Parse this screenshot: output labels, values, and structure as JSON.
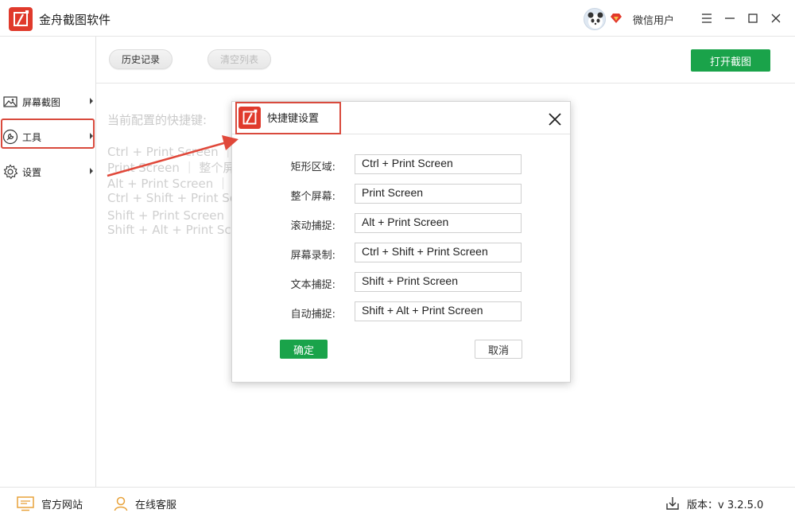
{
  "app": {
    "title": "金舟截图软件"
  },
  "header": {
    "user_name": "微信用户"
  },
  "sidebar": {
    "items": [
      {
        "label": "屏幕截图"
      },
      {
        "label": "工具"
      },
      {
        "label": "设置"
      }
    ]
  },
  "toolbar": {
    "history_label": "历史记录",
    "clear_label": "清空列表",
    "open_label": "打开截图"
  },
  "main": {
    "current_label": "当前配置的快捷键:",
    "lines": [
      "Ctrl + Print Screen ｜ 矩",
      "Print Screen ｜ 整个屏",
      "Alt + Print Screen ｜ 滚",
      "Ctrl + Shift + Print Scre",
      "Shift + Print Screen ｜",
      "Shift + Alt + Print Scre"
    ]
  },
  "dialog": {
    "title": "快捷键设置",
    "rows": [
      {
        "label": "矩形区域:",
        "value": "Ctrl + Print Screen"
      },
      {
        "label": "整个屏幕:",
        "value": "Print Screen"
      },
      {
        "label": "滚动捕捉:",
        "value": "Alt + Print Screen"
      },
      {
        "label": "屏幕录制:",
        "value": "Ctrl + Shift + Print Screen"
      },
      {
        "label": "文本捕捉:",
        "value": "Shift + Print Screen"
      },
      {
        "label": "自动捕捉:",
        "value": "Shift + Alt + Print Screen"
      }
    ],
    "ok_label": "确定",
    "cancel_label": "取消"
  },
  "footer": {
    "website_label": "官方网站",
    "service_label": "在线客服",
    "version_label": "版本：v 3.2.5.0"
  },
  "colors": {
    "accent": "#1aa34a",
    "brand": "#e03a2c",
    "highlight": "#d94a3d"
  }
}
